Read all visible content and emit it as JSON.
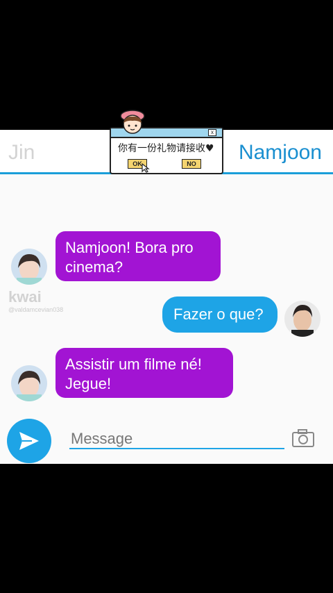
{
  "header": {
    "left_name": "Jin",
    "right_name": "Namjoon"
  },
  "popup": {
    "text": "你有一份礼物请接收♥",
    "ok_label": "OK",
    "no_label": "NO",
    "close_label": "x"
  },
  "watermark": {
    "logo": "kwai",
    "user": "@valdamcevian038"
  },
  "messages": [
    {
      "sender": "Jin",
      "lines": [
        "Namjoon! Bora pro",
        "cinema?"
      ]
    },
    {
      "sender": "Namjoon",
      "lines": [
        "Fazer o que?"
      ]
    },
    {
      "sender": "Jin",
      "lines": [
        "Assistir um filme né!",
        "Jegue!"
      ]
    }
  ],
  "composer": {
    "placeholder": "Message"
  },
  "colors": {
    "accent_blue": "#1ea4e6",
    "purple_bubble": "#a214d3",
    "header_underline": "#1a9ed9"
  },
  "icons": {
    "send": "send-arrow-icon",
    "camera": "camera-icon",
    "popup_close": "close-icon",
    "cursor": "cursor-icon",
    "decoration": "girl-icon"
  }
}
